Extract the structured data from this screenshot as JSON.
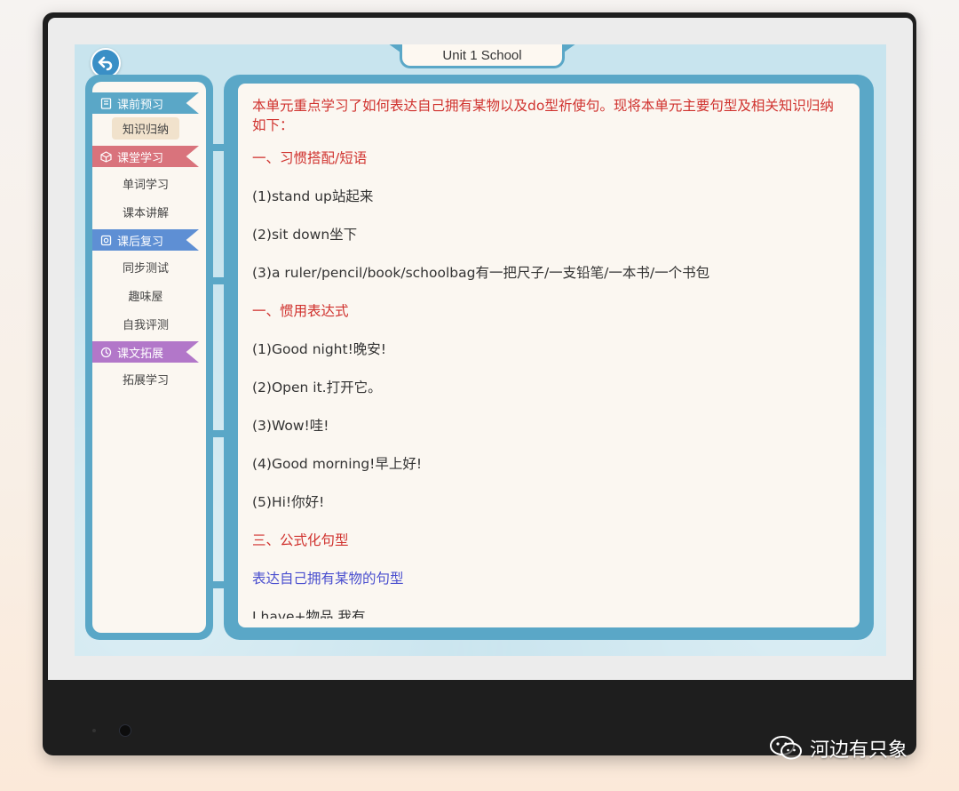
{
  "app": {
    "title": "Unit 1 School"
  },
  "sidebar": {
    "sections": [
      {
        "title": "课前预习",
        "icon": "notebook-icon",
        "color": "#5aa7c7",
        "items": [
          {
            "label": "知识归纳",
            "active": true
          }
        ]
      },
      {
        "title": "课堂学习",
        "icon": "cube-icon",
        "color": "#d9737c",
        "items": [
          {
            "label": "单词学习"
          },
          {
            "label": "课本讲解"
          }
        ]
      },
      {
        "title": "课后复习",
        "icon": "review-icon",
        "color": "#5e8fd4",
        "items": [
          {
            "label": "同步测试"
          },
          {
            "label": "趣味屋"
          },
          {
            "label": "自我评测"
          }
        ]
      },
      {
        "title": "课文拓展",
        "icon": "clock-icon",
        "color": "#b277c9",
        "items": [
          {
            "label": "拓展学习"
          }
        ]
      }
    ]
  },
  "content": {
    "intro": "本单元重点学习了如何表达自己拥有某物以及do型祈使句。现将本单元主要句型及相关知识归纳如下：",
    "heading1": "一、习惯搭配/短语",
    "phrases": [
      "(1)stand up站起来",
      "(2)sit down坐下",
      "(3)a ruler/pencil/book/schoolbag有一把尺子/一支铅笔/一本书/一个书包"
    ],
    "heading2": "一、惯用表达式",
    "expressions": [
      "(1)Good night!晚安!",
      "(2)Open it.打开它。",
      "(3)Wow!哇!",
      "(4)Good morning!早上好!",
      "(5)Hi!你好!"
    ],
    "heading3": "三、公式化句型",
    "subheading": "表达自己拥有某物的句型",
    "clipped_line": "I have+物品.我有"
  },
  "watermark": {
    "text": "河边有只象",
    "icon": "wechat-icon"
  },
  "colors": {
    "frame": "#5aa7c7",
    "paper": "#fbf7f1",
    "heading_red": "#d0322e",
    "subheading_blue": "#4a4fcf"
  }
}
